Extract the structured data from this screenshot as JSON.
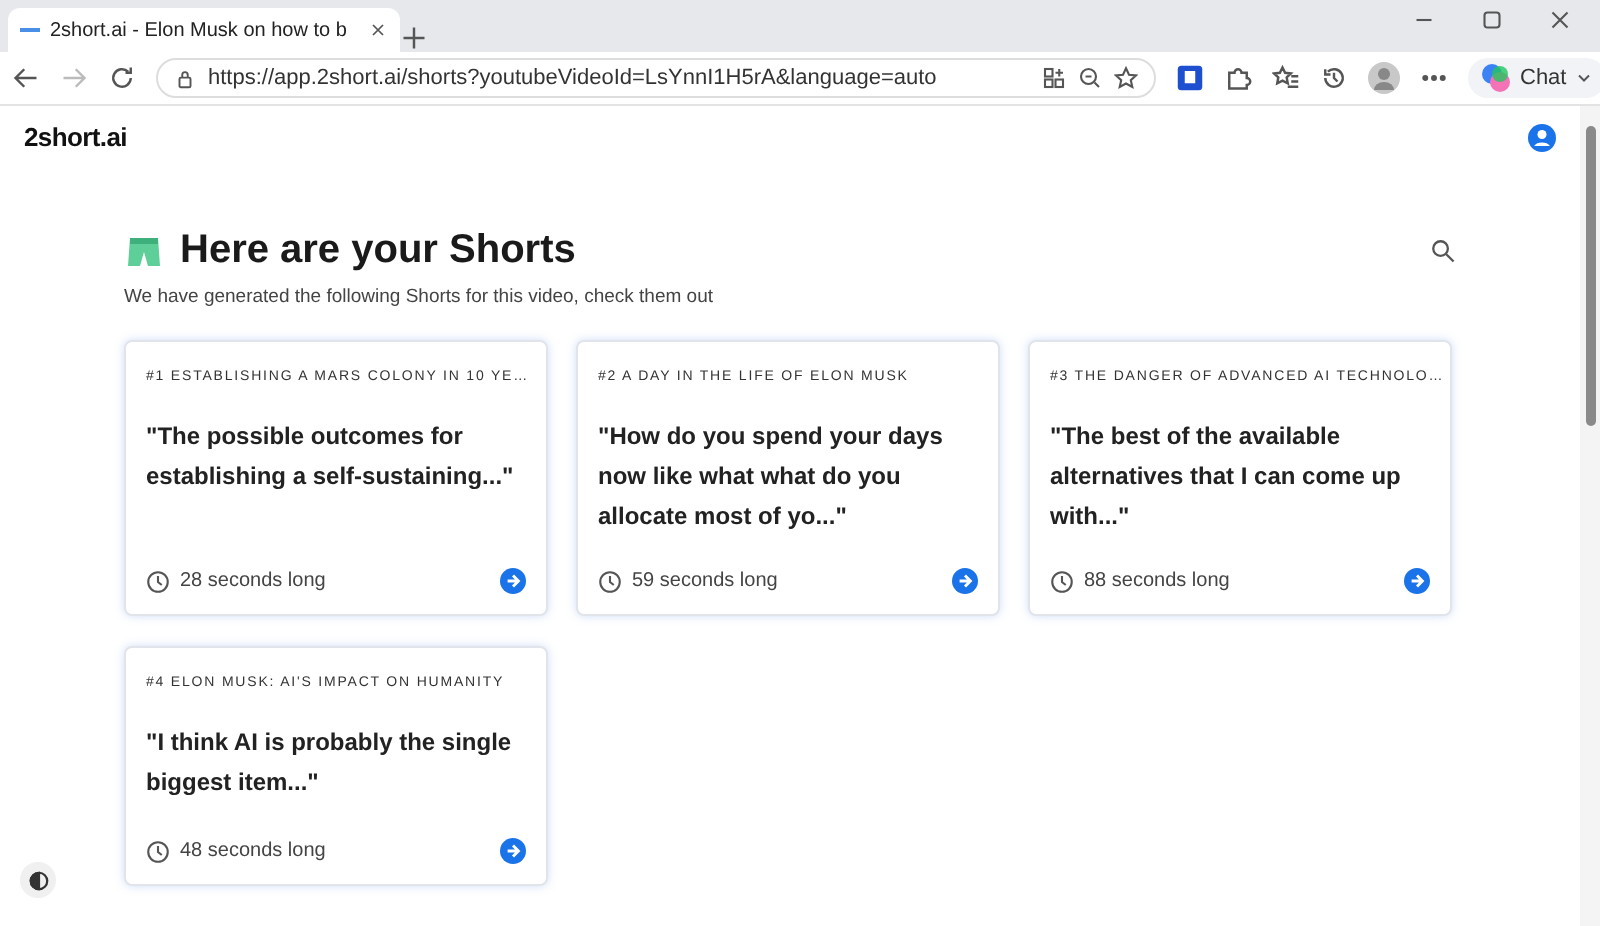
{
  "browser": {
    "tab_title": "2short.ai - Elon Musk on how to b",
    "url": "https://app.2short.ai/shorts?youtubeVideoId=LsYnnI1H5rA&language=auto",
    "chat_label": "Chat"
  },
  "page": {
    "logo": "2short.ai",
    "heading": "Here are your Shorts",
    "subheading": "We have generated the following Shorts for this video, check them out"
  },
  "shorts": [
    {
      "title": "#1 ESTABLISHING A MARS COLONY IN 10 YE…",
      "quote": "\"The possible outcomes for establishing a self-sustaining...\"",
      "duration": "28 seconds long"
    },
    {
      "title": "#2 A DAY IN THE LIFE OF ELON MUSK",
      "quote": "\"How do you spend your days now like what what do you allocate most of yo...\"",
      "duration": "59 seconds long"
    },
    {
      "title": "#3 THE DANGER OF ADVANCED AI TECHNOLO…",
      "quote": "\"The best of the available alternatives that I can come up with...\"",
      "duration": "88 seconds long"
    },
    {
      "title": "#4 ELON MUSK: AI'S IMPACT ON HUMANITY",
      "quote": "\"I think AI is probably the single biggest item...\"",
      "duration": "48 seconds long"
    }
  ]
}
